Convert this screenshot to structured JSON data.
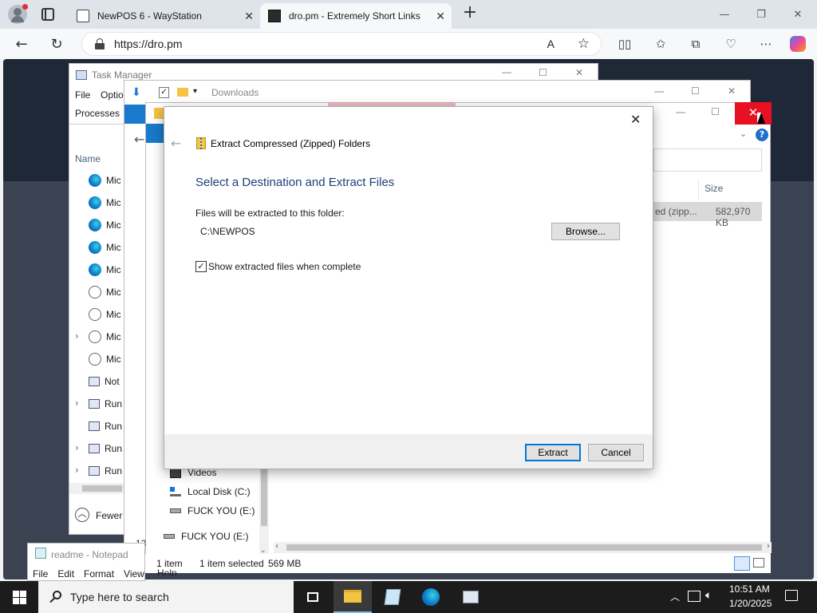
{
  "browser": {
    "tabs": [
      {
        "label": "NewPOS 6 - WayStation",
        "active": false
      },
      {
        "label": "dro.pm - Extremely Short Links",
        "active": true
      }
    ],
    "new_tab_symbol": "+",
    "url": "https://dro.pm",
    "read_aloud_label": "A",
    "accent": "#0078d7"
  },
  "task_manager": {
    "title": "Task Manager",
    "menu": [
      "File",
      "Optio"
    ],
    "tab_processes": "Processes",
    "column_name": "Name",
    "rows": [
      "Mic",
      "Mic",
      "Mic",
      "Mic",
      "Mic",
      "Mic",
      "Mic",
      "Mic",
      "Mic",
      "Not",
      "Run",
      "Run",
      "Run",
      "Run"
    ],
    "footer": "Fewer d"
  },
  "explorer": {
    "title": "Downloads",
    "size_column": "Size",
    "file_type_partial": "ed (zipp...",
    "file_size": "582,970 KB",
    "nav_items": [
      "Videos",
      "Local Disk (C:)",
      "FUCK YOU (E:)",
      "FUCK YOU (E:)"
    ],
    "status_items": "1 item",
    "status_selected": "1 item selected",
    "status_size": "569 MB",
    "status_left": "13"
  },
  "dialog": {
    "header": "Extract Compressed (Zipped) Folders",
    "heading": "Select a Destination and Extract Files",
    "dest_label": "Files will be extracted to this folder:",
    "dest_value": "C:\\NEWPOS",
    "browse_button": "Browse...",
    "checkbox_label": "Show extracted files when complete",
    "checkbox_checked": true,
    "extract_button": "Extract",
    "cancel_button": "Cancel",
    "heading_color": "#003399"
  },
  "notepad": {
    "title": "readme - Notepad",
    "menu": [
      "File",
      "Edit",
      "Format",
      "View",
      "Help"
    ]
  },
  "taskbar": {
    "search_placeholder": "Type here to search",
    "time": "10:51 AM",
    "date": "1/20/2025"
  }
}
